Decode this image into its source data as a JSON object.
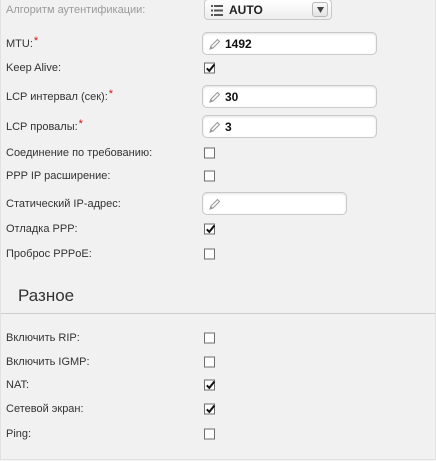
{
  "ppp": {
    "auth_label": "Алгоритм аутентификации:",
    "auth_value": "AUTO",
    "mtu_label": "MTU:",
    "mtu_value": "1492",
    "keepalive_label": "Keep Alive:",
    "keepalive_checked": true,
    "lcp_interval_label": "LCP интервал (сек):",
    "lcp_interval_value": "30",
    "lcp_fail_label": "LCP провалы:",
    "lcp_fail_value": "3",
    "on_demand_label": "Соединение по требованию:",
    "on_demand_checked": false,
    "ip_ext_label": "PPP IP расширение:",
    "ip_ext_checked": false,
    "static_ip_label": "Статический IP-адрес:",
    "static_ip_value": "",
    "debug_label": "Отладка PPP:",
    "debug_checked": true,
    "pppoe_label": "Проброс PPPoE:",
    "pppoe_checked": false,
    "required_mark": "*"
  },
  "misc": {
    "title": "Разное",
    "rip_label": "Включить RIP:",
    "rip_checked": false,
    "igmp_label": "Включить IGMP:",
    "igmp_checked": false,
    "nat_label": "NAT:",
    "nat_checked": true,
    "firewall_label": "Сетевой экран:",
    "firewall_checked": true,
    "ping_label": "Ping:",
    "ping_checked": false
  },
  "icons": {
    "pencil": "pencil-icon",
    "list": "list-icon",
    "dropdown": "chevron-down-icon",
    "check": "checkmark-icon"
  }
}
